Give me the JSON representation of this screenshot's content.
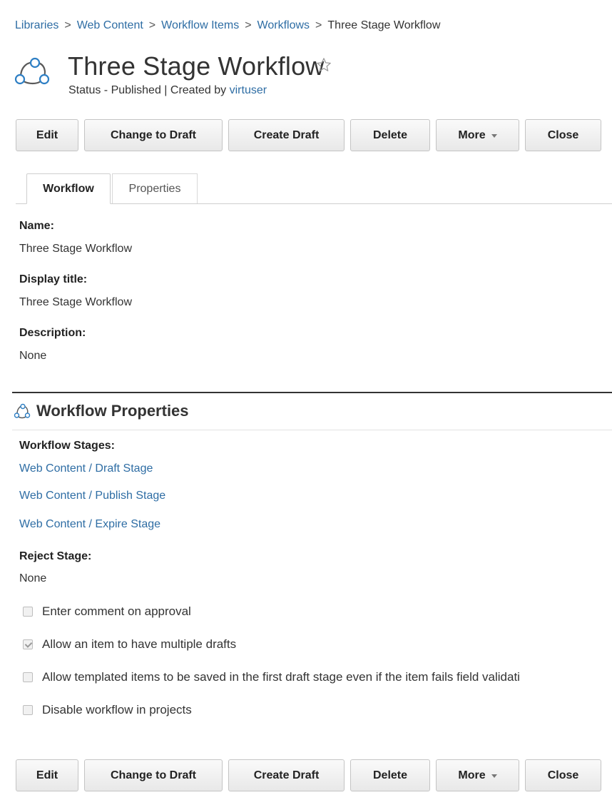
{
  "breadcrumb": {
    "items": [
      "Libraries",
      "Web Content",
      "Workflow Items",
      "Workflows"
    ],
    "current": "Three Stage Workflow",
    "separator": ">"
  },
  "header": {
    "title": "Three Stage Workflow",
    "status_prefix": "Status - Published | Created by ",
    "created_by": "virtuser",
    "icon": "workflow-icon",
    "favorite_icon": "star-outline-icon"
  },
  "toolbar": {
    "edit": "Edit",
    "change_to_draft": "Change to Draft",
    "create_draft": "Create Draft",
    "delete": "Delete",
    "more": "More",
    "close": "Close"
  },
  "tabs": {
    "workflow": "Workflow",
    "properties": "Properties"
  },
  "fields": {
    "name_label": "Name:",
    "name_value": "Three Stage Workflow",
    "display_title_label": "Display title:",
    "display_title_value": "Three Stage Workflow",
    "description_label": "Description:",
    "description_value": "None"
  },
  "workflow_properties": {
    "title": "Workflow Properties",
    "stages_label": "Workflow Stages:",
    "stages": [
      "Web Content / Draft Stage",
      "Web Content / Publish Stage",
      "Web Content / Expire Stage"
    ],
    "reject_label": "Reject Stage:",
    "reject_value": "None",
    "options": [
      {
        "label": "Enter comment on approval",
        "checked": false
      },
      {
        "label": "Allow an item to have multiple drafts",
        "checked": true
      },
      {
        "label": "Allow templated items to be saved in the first draft stage even if the item fails field validati",
        "checked": false
      },
      {
        "label": "Disable workflow in projects",
        "checked": false
      }
    ]
  },
  "colors": {
    "link": "#2e6da4",
    "text": "#333333"
  }
}
